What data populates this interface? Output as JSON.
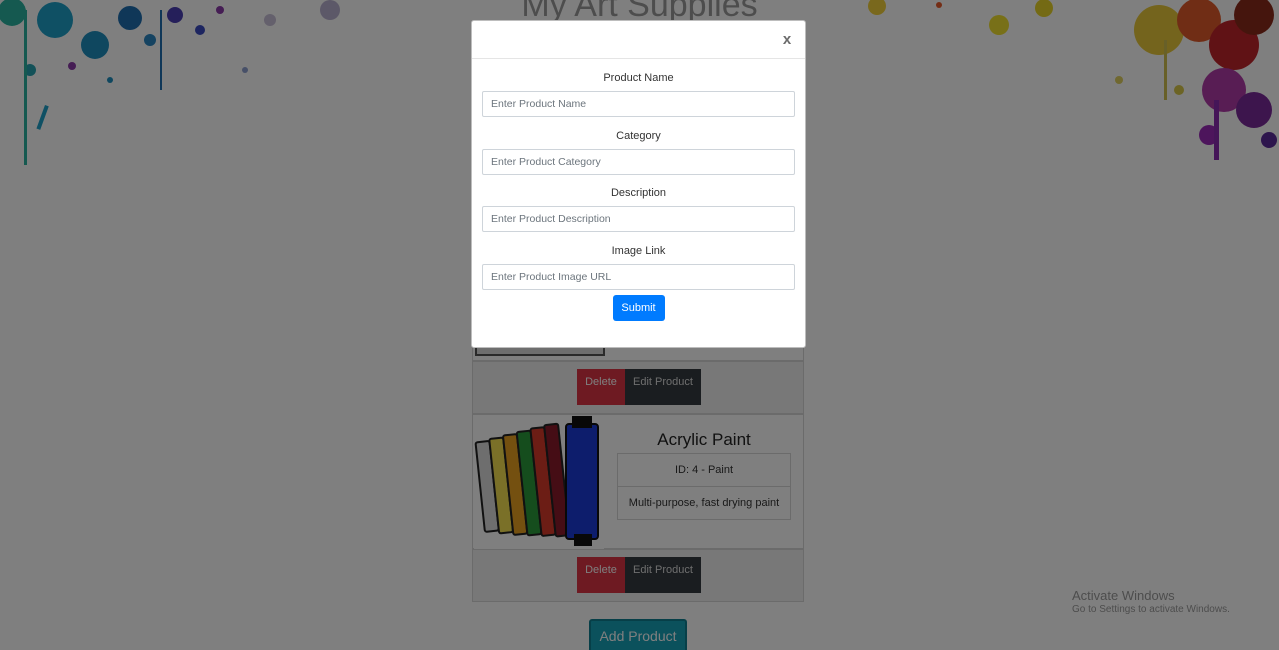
{
  "site": {
    "title": "My Art Supplies"
  },
  "products": [
    {
      "name": "Acrylic Paint",
      "meta": "ID: 4 - Paint",
      "description": "Multi-purpose, fast drying paint",
      "delete_label": "Delete",
      "edit_label": "Edit Product"
    }
  ],
  "first_card_actions": {
    "delete_label": "Delete",
    "edit_label": "Edit Product"
  },
  "add_product_label": "Add Product",
  "modal": {
    "close_label": "x",
    "fields": [
      {
        "label": "Product Name",
        "placeholder": "Enter Product Name"
      },
      {
        "label": "Category",
        "placeholder": "Enter Product Category"
      },
      {
        "label": "Description",
        "placeholder": "Enter Product Description"
      },
      {
        "label": "Image Link",
        "placeholder": "Enter Product Image URL"
      }
    ],
    "submit_label": "Submit"
  },
  "os_watermark": {
    "line1": "Activate Windows",
    "line2": "Go to Settings to activate Windows."
  },
  "colors": {
    "delete": "#dc3545",
    "edit": "#343a40",
    "submit": "#007bff",
    "add_product": "#17a2b8"
  }
}
